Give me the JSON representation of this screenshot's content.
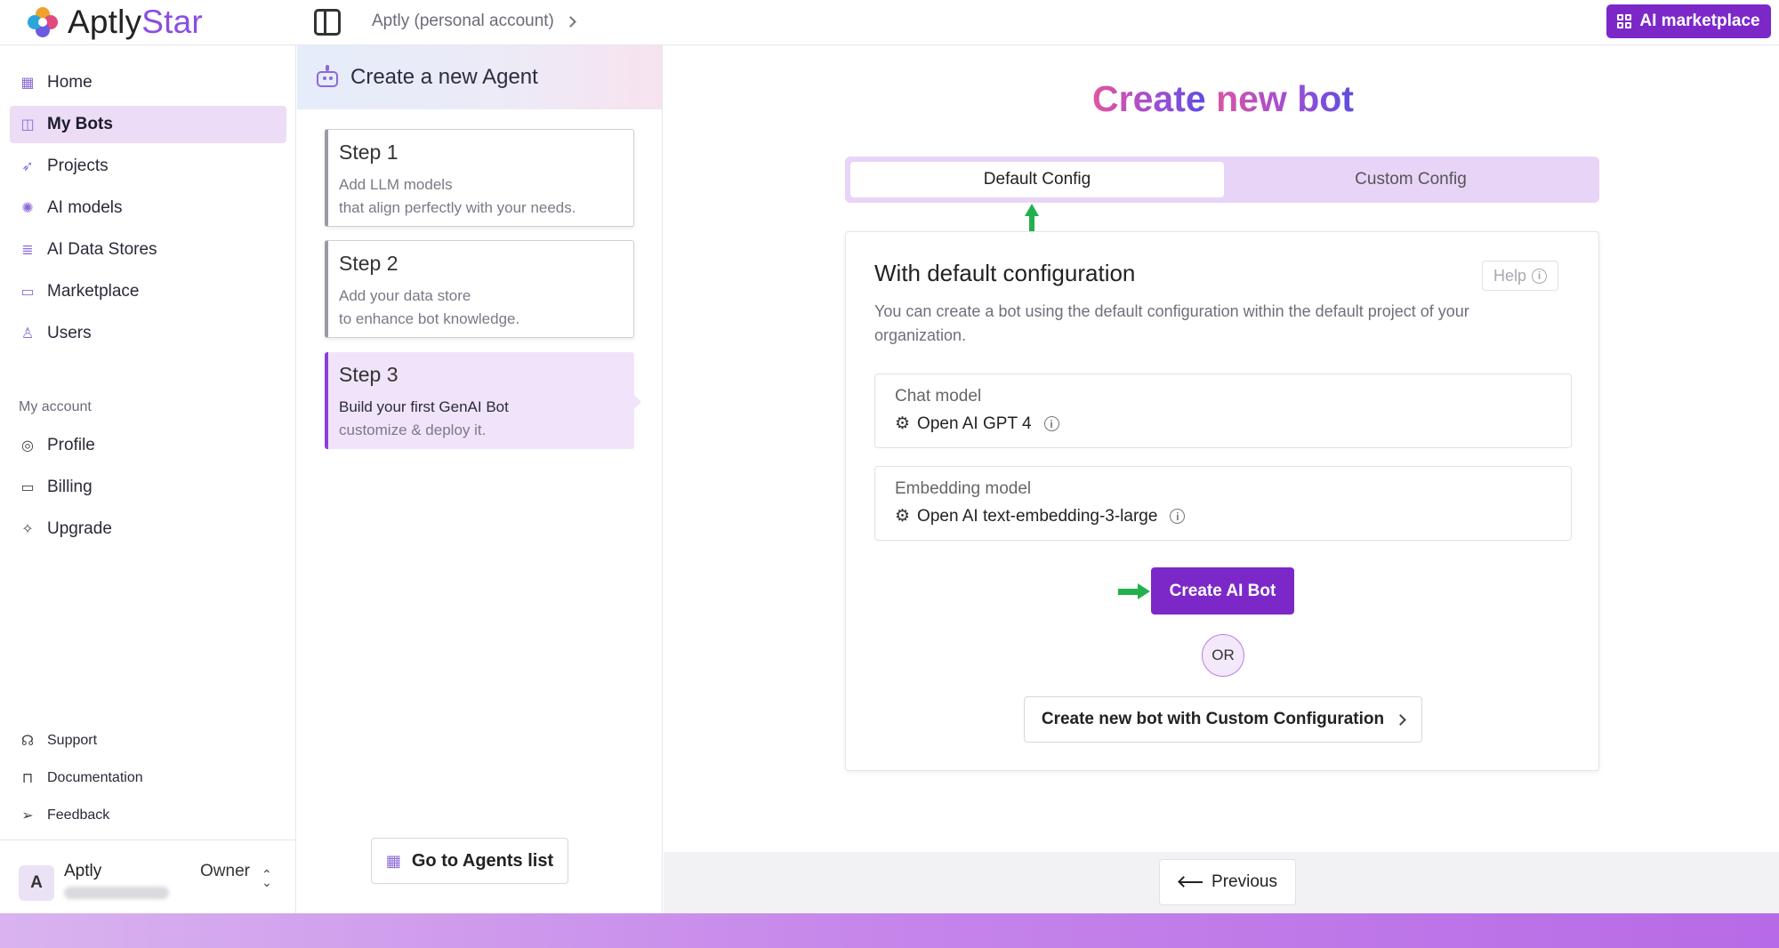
{
  "app": {
    "name_prefix": "Aptly",
    "name_suffix": "Star"
  },
  "header": {
    "breadcrumb": "Aptly (personal account)",
    "marketplace_button": "AI marketplace"
  },
  "sidebar": {
    "items": [
      {
        "label": "Home",
        "icon": "home-grid-icon"
      },
      {
        "label": "My Bots",
        "icon": "bot-icon",
        "active": true
      },
      {
        "label": "Projects",
        "icon": "rocket-icon"
      },
      {
        "label": "AI models",
        "icon": "ai-model-icon"
      },
      {
        "label": "AI Data Stores",
        "icon": "database-icon"
      },
      {
        "label": "Marketplace",
        "icon": "store-icon"
      },
      {
        "label": "Users",
        "icon": "user-icon"
      }
    ],
    "account_section_label": "My account",
    "account_items": [
      {
        "label": "Profile",
        "icon": "check-circle-icon"
      },
      {
        "label": "Billing",
        "icon": "card-icon"
      },
      {
        "label": "Upgrade",
        "icon": "sparkle-icon"
      }
    ],
    "support_items": [
      {
        "label": "Support",
        "icon": "headset-icon"
      },
      {
        "label": "Documentation",
        "icon": "book-icon"
      },
      {
        "label": "Feedback",
        "icon": "send-icon"
      }
    ],
    "user": {
      "initial": "A",
      "name": "Aptly",
      "role": "Owner"
    }
  },
  "steps_panel": {
    "title": "Create a new Agent",
    "steps": [
      {
        "title": "Step 1",
        "line1": "Add LLM models",
        "line2": "that align perfectly with your needs."
      },
      {
        "title": "Step 2",
        "line1": "Add your data store",
        "line2": "to enhance bot knowledge."
      },
      {
        "title": "Step 3",
        "line1": "Build your first GenAI Bot",
        "line2": "customize & deploy it.",
        "active": true
      }
    ],
    "agents_button": "Go to Agents list"
  },
  "main": {
    "title_part1": "Create",
    "title_part2": " new bot",
    "tabs": [
      {
        "label": "Default Config",
        "selected": true
      },
      {
        "label": "Custom Config",
        "selected": false
      }
    ],
    "card": {
      "title": "With default configuration",
      "help_label": "Help",
      "description": "You can create a bot using the default configuration within the default project of your organization.",
      "chat_model": {
        "label": "Chat model",
        "value": "Open AI GPT 4"
      },
      "embedding_model": {
        "label": "Embedding model",
        "value": "Open AI text-embedding-3-large"
      },
      "create_button": "Create AI Bot",
      "or_label": "OR",
      "custom_button": "Create new bot with Custom Configuration"
    },
    "previous_button": "Previous"
  },
  "colors": {
    "accent": "#7c28c9",
    "active_nav_bg": "#ecdcf6",
    "tab_track": "#e8d4f7",
    "annotation_arrow": "#22b14c"
  }
}
